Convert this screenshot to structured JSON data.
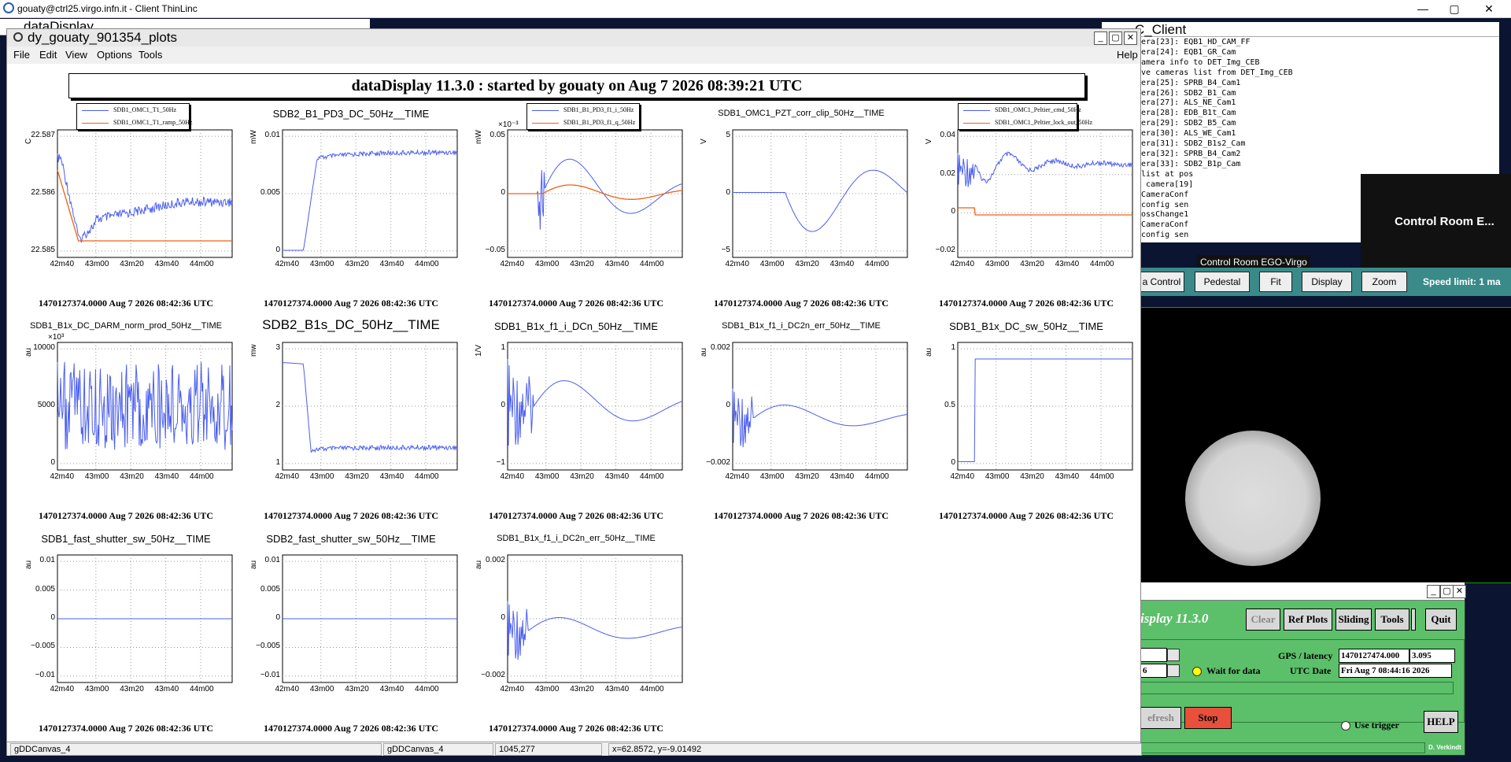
{
  "outer": {
    "title": "gouaty@ctrl25.virgo.infn.it - Client ThinLinc",
    "min": "—",
    "max": "▢",
    "close": "✕"
  },
  "bg_window": {
    "title": "dataDisplay"
  },
  "main": {
    "title": "dy_gouaty_901354_plots",
    "menu": [
      "File",
      "Edit",
      "View",
      "Options",
      "Tools"
    ],
    "help": "Help",
    "banner": "dataDisplay 11.3.0 : started by gouaty on Aug  7 2026 08:39:21 UTC",
    "footer_time": "1470127374.0000 Aug 7 2026 08:42:36 UTC",
    "x_ticks": [
      "42m40",
      "43m00",
      "43m20",
      "43m40",
      "44m00"
    ],
    "plots": [
      {
        "title": "",
        "ylabel": "C",
        "yticks": [
          "22.587",
          "22.586",
          "22.585"
        ],
        "exp": "",
        "legend": [
          "SDB1_OMC1_T1_50Hz",
          "SDB1_OMC1_T1_ramp_50Hz"
        ],
        "size": "normal"
      },
      {
        "title": "SDB2_B1_PD3_DC_50Hz__TIME",
        "ylabel": "mW",
        "yticks": [
          "0.01",
          "0.005",
          "0"
        ],
        "exp": "",
        "legend": [],
        "size": "normal"
      },
      {
        "title": "",
        "ylabel": "mW",
        "yticks": [
          "0.05",
          "0",
          "−0.05"
        ],
        "exp": "×10⁻³",
        "legend": [
          "SDB1_B1_PD3_f1_i_50Hz",
          "SDB1_B1_PD3_f1_q_50Hz"
        ],
        "size": "normal"
      },
      {
        "title": "SDB1_OMC1_PZT_corr_clip_50Hz__TIME",
        "ylabel": "V",
        "yticks": [
          "5",
          "0",
          "−5"
        ],
        "exp": "",
        "legend": [],
        "size": "small"
      },
      {
        "title": "",
        "ylabel": "V",
        "yticks": [
          "0.04",
          "0.02",
          "0",
          "−0.02"
        ],
        "exp": "",
        "legend": [
          "SDB1_OMC1_Peltier_cmd_50Hz",
          "SDB1_OMC1_Peltier_lock_out_50Hz"
        ],
        "size": "normal"
      },
      {
        "title": "SDB1_B1x_DC_DARM_norm_prod_50Hz__TIME",
        "ylabel": "au",
        "yticks": [
          "10000",
          "5000",
          "0"
        ],
        "exp": "×10³",
        "legend": [],
        "size": "small"
      },
      {
        "title": "SDB2_B1s_DC_50Hz__TIME",
        "ylabel": "mw",
        "yticks": [
          "3",
          "2",
          "1"
        ],
        "exp": "",
        "legend": [],
        "size": "big"
      },
      {
        "title": "SDB1_B1x_f1_i_DCn_50Hz__TIME",
        "ylabel": "1/V",
        "yticks": [
          "1",
          "0",
          "−1"
        ],
        "exp": "",
        "legend": [],
        "size": "normal"
      },
      {
        "title": "SDB1_B1x_f1_i_DC2n_err_50Hz__TIME",
        "ylabel": "au",
        "yticks": [
          "0.002",
          "0",
          "−0.002"
        ],
        "exp": "",
        "legend": [],
        "size": "small"
      },
      {
        "title": "SDB1_B1x_DC_sw_50Hz__TIME",
        "ylabel": "au",
        "yticks": [
          "1",
          "0.5",
          "0"
        ],
        "exp": "",
        "legend": [],
        "size": "normal"
      },
      {
        "title": "SDB1_fast_shutter_sw_50Hz__TIME",
        "ylabel": "au",
        "yticks": [
          "0.01",
          "0.005",
          "0",
          "−0.005",
          "−0.01"
        ],
        "exp": "",
        "legend": [],
        "size": "normal"
      },
      {
        "title": "SDB2_fast_shutter_sw_50Hz__TIME",
        "ylabel": "au",
        "yticks": [
          "0.01",
          "0.005",
          "0",
          "−0.005",
          "−0.01"
        ],
        "exp": "",
        "legend": [],
        "size": "normal"
      },
      {
        "title": "SDB1_B1x_f1_i_DC2n_err_50Hz__TIME",
        "ylabel": "au",
        "yticks": [
          "0.002",
          "0",
          "−0.002"
        ],
        "exp": "",
        "legend": [],
        "size": "small"
      }
    ],
    "status": [
      "gDDCanvas_4",
      "gDDCanvas_4",
      "1045,277",
      "x=62.8572, y=-9.01492"
    ]
  },
  "camera_client": {
    "title": "C_Client",
    "log": "mera[23]: EQB1_HD_CAM_FF\nmera[24]: EQB1_GR_Cam\ncamera info to DET_Img_CEB\nive cameras list from DET_Img_CEB\nmera[25]: SPRB_B4_Cam1\nmera[26]: SDB2_B1_Cam\nmera[27]: ALS_NE_Cam1\nmera[28]: EDB_B1t_Cam\nmera[29]: SDB2_B5_Cam\nmera[30]: ALS_WE_Cam1\nmera[31]: SDB2_B1s2_Cam\nmera[32]: SPRB_B4_Cam2\nmera[33]: SDB2_B1p_Cam\n list at pos\nt camera[19]\ndCameraConf\n config sen\nrossChange1\ndCameraConf\n config sen"
  },
  "camera_controls": [
    "a Control",
    "Pedestal",
    "Fit",
    "Display",
    "Zoom"
  ],
  "speed_limit": "Speed limit: 1 ma",
  "tooltip_dark": "Control Room E...",
  "tooltip": "Control Room EGO-Virgo",
  "dd_panel": {
    "title": "isplay  11.3.0",
    "buttons": [
      "Clear",
      "Ref Plots",
      "Sliding",
      "Tools",
      "Quit"
    ],
    "gps_label": "GPS / latency",
    "gps_value": "1470127474.000",
    "latency_value": "3.095",
    "utc_label": "UTC Date",
    "utc_value": "Fri Aug  7 08:44:16 2026",
    "wait_label": "Wait for data",
    "small_value": "6",
    "refresh": "efresh",
    "stop": "Stop",
    "use_trigger": "Use trigger",
    "help": "HELP",
    "author": "D. Verkindt"
  }
}
